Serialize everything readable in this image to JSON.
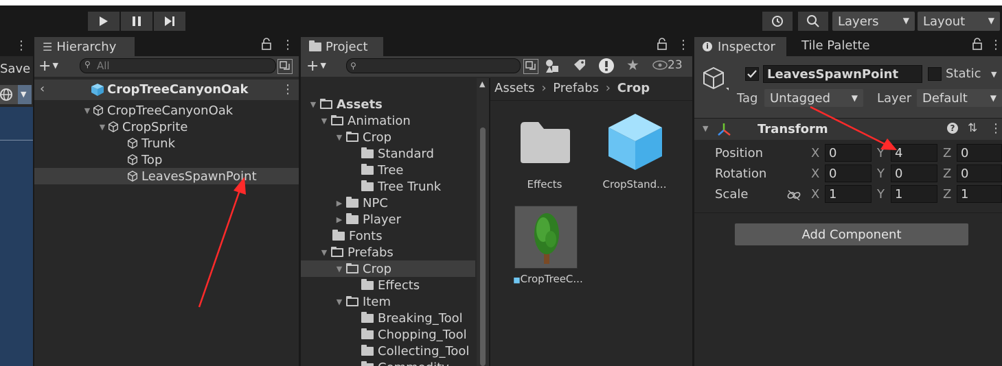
{
  "toolbar": {
    "play_icon": "play-icon",
    "pause_icon": "pause-icon",
    "step_icon": "step-icon",
    "layers_label": "Layers",
    "layout_label": "Layout"
  },
  "scene_strip": {
    "save_label": "Save"
  },
  "hierarchy": {
    "tab_label": "Hierarchy",
    "search_placeholder": "All",
    "prefab_title": "CropTreeCanyonOak",
    "items": [
      {
        "label": "CropTreeCanyonOak"
      },
      {
        "label": "CropSprite"
      },
      {
        "label": "Trunk"
      },
      {
        "label": "Top"
      },
      {
        "label": "LeavesSpawnPoint"
      }
    ]
  },
  "project": {
    "tab_label": "Project",
    "badge_count": "23",
    "tree": [
      {
        "label": "Assets"
      },
      {
        "label": "Animation"
      },
      {
        "label": "Crop"
      },
      {
        "label": "Standard"
      },
      {
        "label": "Tree"
      },
      {
        "label": "Tree Trunk"
      },
      {
        "label": "NPC"
      },
      {
        "label": "Player"
      },
      {
        "label": "Fonts"
      },
      {
        "label": "Prefabs"
      },
      {
        "label": "Crop"
      },
      {
        "label": "Effects"
      },
      {
        "label": "Item"
      },
      {
        "label": "Breaking_Tool"
      },
      {
        "label": "Chopping_Tool"
      },
      {
        "label": "Collecting_Tool"
      },
      {
        "label": "Commodity"
      }
    ],
    "breadcrumb": [
      "Assets",
      "Prefabs",
      "Crop"
    ],
    "assets": [
      {
        "label": "Effects"
      },
      {
        "label": "CropStand..."
      },
      {
        "label": "CropTreeC..."
      }
    ]
  },
  "inspector": {
    "tab_label": "Inspector",
    "tab2_label": "Tile Palette",
    "object_name": "LeavesSpawnPoint",
    "static_label": "Static",
    "tag_label": "Tag",
    "tag_value": "Untagged",
    "layer_label": "Layer",
    "layer_value": "Default",
    "transform_label": "Transform",
    "rows": [
      {
        "label": "Position",
        "x": "0",
        "y": "4",
        "z": "0"
      },
      {
        "label": "Rotation",
        "x": "0",
        "y": "0",
        "z": "0"
      },
      {
        "label": "Scale",
        "x": "1",
        "y": "1",
        "z": "1"
      }
    ],
    "axis_x": "X",
    "axis_y": "Y",
    "axis_z": "Z",
    "add_component_label": "Add Component"
  },
  "colors": {
    "annotation_arrow": "#ff2a2a",
    "prefab_blue": "#6fc6f2",
    "selection": "#3e3e3e"
  }
}
